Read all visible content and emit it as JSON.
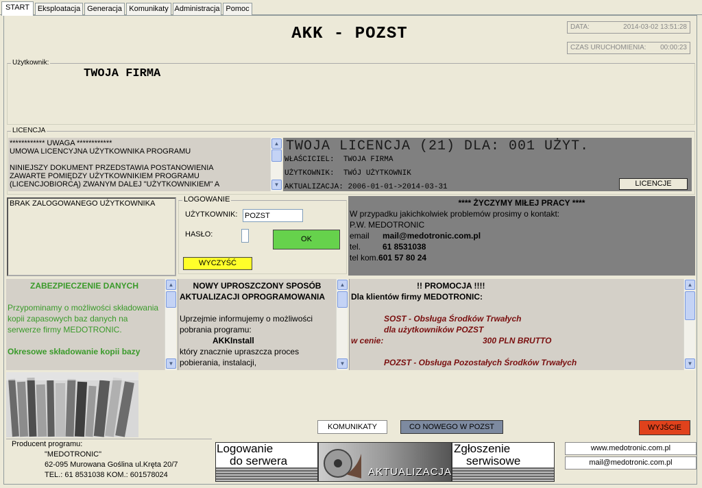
{
  "tabs": [
    "START",
    "Eksploatacja",
    "Generacja",
    "Komunikaty",
    "Administracja",
    "Pomoc"
  ],
  "header": {
    "title": "AKK - POZST",
    "date_label": "DATA:",
    "date_value": "2014-03-02 13:51:28",
    "uptime_label": "CZAS URUCHOMIENIA:",
    "uptime_value": "00:00:23"
  },
  "user_box": {
    "label": "Użytkownik:",
    "company": "TWOJA FIRMA"
  },
  "license": {
    "group_title": "LICENCJA",
    "text_lines": [
      "************ UWAGA ************",
      "UMOWA LICENCYJNA UŻYTKOWNIKA PROGRAMU",
      "",
      "NINIEJSZY DOKUMENT PRZEDSTAWIA POSTANOWIENIA",
      "ZAWARTE POMIĘDZY UŻYTKOWNIKIEM PROGRAMU",
      "(LICENCJOBIORCĄ) ZWANYM DALEJ \"UŻYTKOWNIKIEM\" A"
    ],
    "headline": "TWOJA LICENCJA (21) DLA: 001 UŻYT.",
    "owner_label": "WŁAŚCICIEL:",
    "owner_value": "TWOJA FIRMA",
    "user_label": "UŻYTKOWNIK:",
    "user_value": "TWÓJ UŻYTKOWNIK",
    "update_label": "AKTUALIZACJA:",
    "update_value": "2006-01-01->2014-03-31",
    "button": "LICENCJE"
  },
  "login_status": "BRAK ZALOGOWANEGO UŻYTKOWNIKA",
  "login": {
    "group_title": "LOGOWANIE",
    "user_label": "UŻYTKOWNIK:",
    "user_value": "POZST",
    "password_label": "HASŁO:",
    "ok_button": "OK",
    "clear_button": "WYCZYŚĆ"
  },
  "contact": {
    "title": "**** ŻYCZYMY MIŁEJ PRACY ****",
    "line1": "W przypadku jakichkolwiek problemów prosimy o kontakt:",
    "company": "P.W. MEDOTRONIC",
    "email_label": "email",
    "email_value": "mail@medotronic.com.pl",
    "tel_label": "tel.",
    "tel_value": "61 8531038",
    "telkom_label": "tel kom.",
    "telkom_value": "601 57 80 24"
  },
  "news1": {
    "title": "ZABEZPIECZENIE DANYCH",
    "body": "Przypominamy o możliwości składowania kopii zapasowych baz danych na serwerze firmy MEDOTRONIC.",
    "footer": "Okresowe składowanie kopii bazy"
  },
  "news2": {
    "title_line1": "NOWY UPROSZCZONY SPOSÓB",
    "title_line2": "AKTUALIZACJI OPROGRAMOWANIA",
    "body1": "Uprzejmie informujemy o możliwości pobrania programu:",
    "program": "AKKInstall",
    "body2": "który znacznie upraszcza proces pobierania, instalacji,"
  },
  "news3": {
    "title": "!! PROMOCJA !!!!",
    "subtitle": "Dla klientów firmy MEDOTRONIC:",
    "item1_line1": "SOST - Obsługa Środków Trwałych",
    "item1_line2": "dla użytkowników POZST",
    "price_label": "w cenie:",
    "price_value": "300 PLN BRUTTO",
    "item2": "POZST - Obsługa Pozostałych Środków Trwałych"
  },
  "buttons": {
    "messages": "KOMUNIKATY",
    "whats_new": "CO NOWEGO W POZST",
    "exit": "WYJŚCIE"
  },
  "producer": {
    "label": "Producent programu:",
    "name": "\"MEDOTRONIC\"",
    "address": "62-095 Murowana Goślina ul.Kręta 20/7",
    "phones": "TEL.: 61 8531038   KOM.: 601578024"
  },
  "banners": {
    "login_line1": "Logowanie",
    "login_line2": "do serwera",
    "update": "AKTUALIZACJA",
    "service_line1": "Zgłoszenie",
    "service_line2": "serwisowe"
  },
  "links": {
    "website": "www.medotronic.com.pl",
    "email": "mail@medotronic.com.pl"
  }
}
